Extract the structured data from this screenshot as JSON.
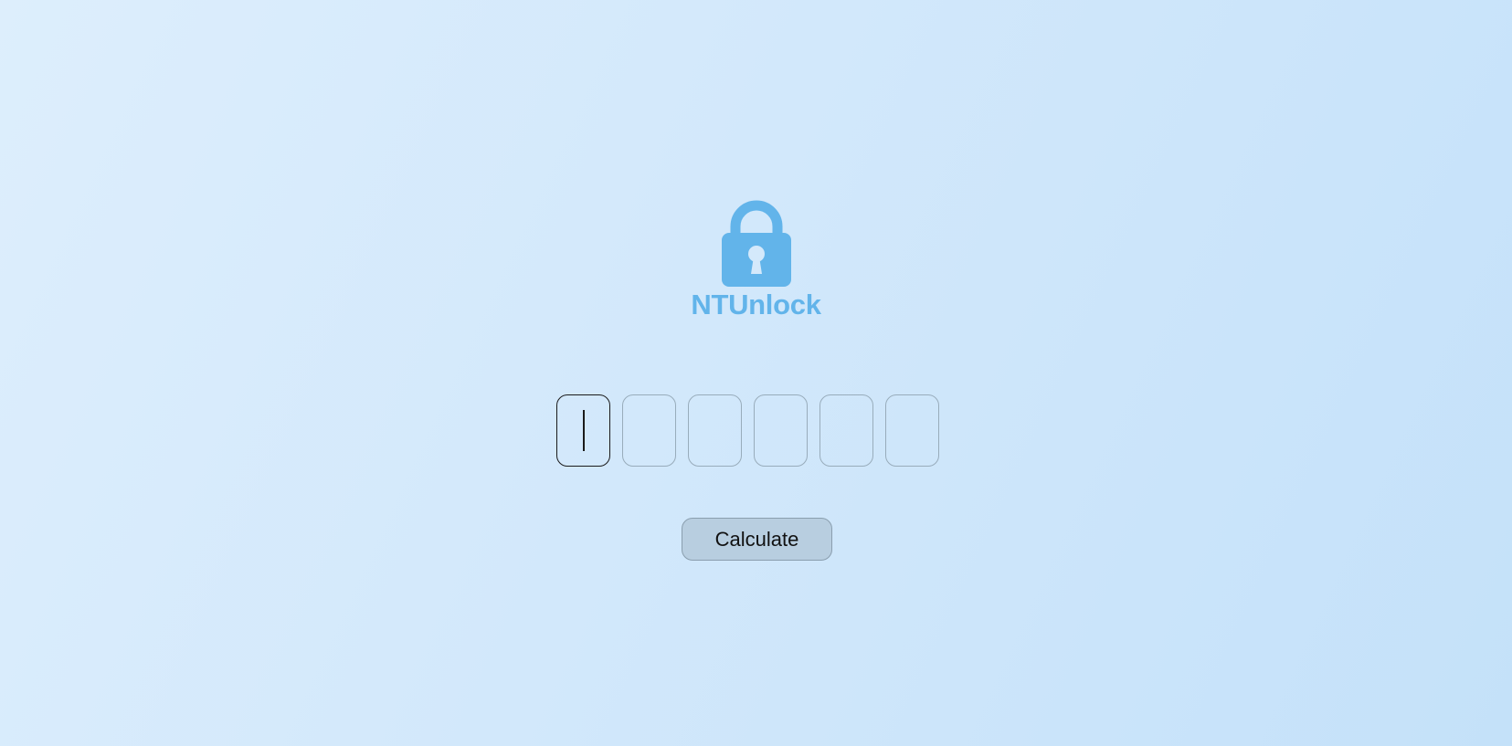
{
  "app": {
    "name": "NTUnlock",
    "brand_color": "#62b4ea",
    "logo_icon": "padlock-icon"
  },
  "code_entry": {
    "digits": [
      "",
      "",
      "",
      "",
      "",
      ""
    ],
    "active_index": 0
  },
  "actions": {
    "calculate_label": "Calculate"
  }
}
